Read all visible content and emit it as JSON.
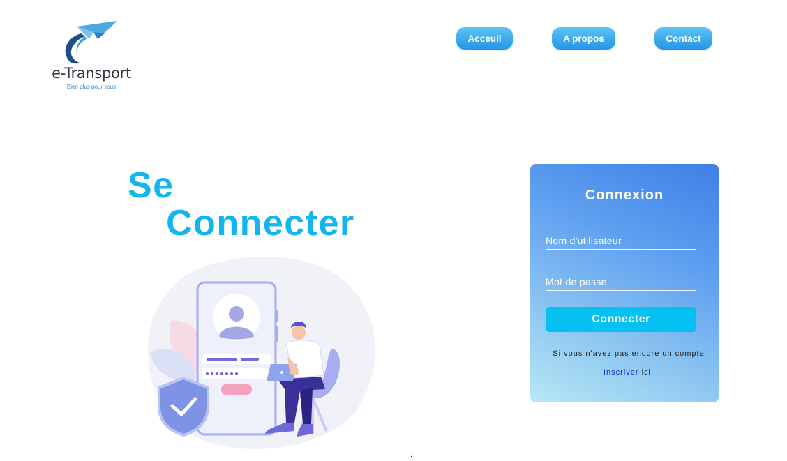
{
  "logo": {
    "name": "e-Transport",
    "tagline": "Bien plus pour vous",
    "icon": "paper-plane-icon"
  },
  "nav": {
    "items": [
      {
        "label": "Acceuil"
      },
      {
        "label": "A propos"
      },
      {
        "label": "Contact"
      }
    ]
  },
  "hero": {
    "line1": "Se",
    "line2": "Connecter",
    "illustration": "phone-login-illustration"
  },
  "login": {
    "title": "Connexion",
    "username_placeholder": "Nom d'utilisateur",
    "username_value": "",
    "password_placeholder": "Mot de passe",
    "password_value": "",
    "submit_label": "Connecter",
    "note": "Si vous n'avez pas encore un compte",
    "signup_link": "Inscriver",
    "signup_suffix": " ici"
  },
  "stray_text": ":",
  "colors": {
    "accent": "#11b6ee",
    "nav_button": "#2a9ce9",
    "panel_start": "#b7e8f5",
    "panel_end": "#3f7fe6",
    "submit_button": "#06c0f2"
  }
}
